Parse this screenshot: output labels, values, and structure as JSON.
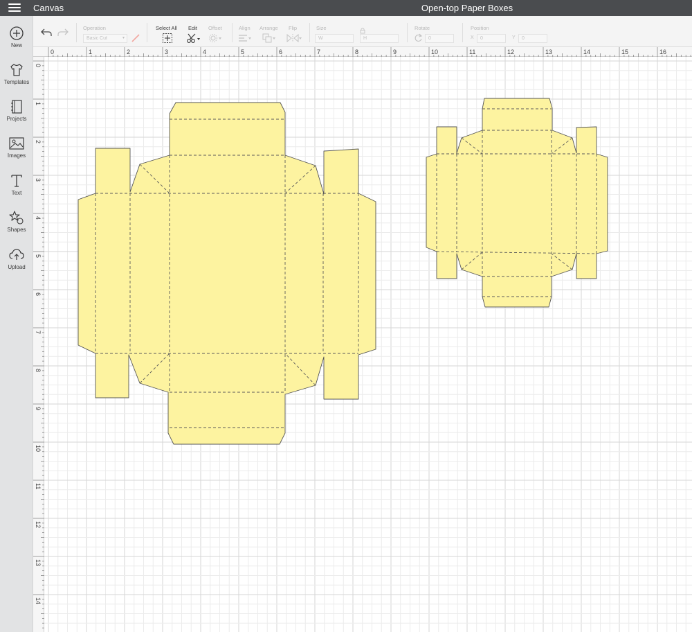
{
  "header": {
    "app_title": "Canvas",
    "project_title": "Open-top Paper Boxes"
  },
  "sidebar": {
    "items": [
      {
        "label": "New",
        "icon": "plus-circle-icon"
      },
      {
        "label": "Templates",
        "icon": "tshirt-icon"
      },
      {
        "label": "Projects",
        "icon": "notebook-icon"
      },
      {
        "label": "Images",
        "icon": "image-icon"
      },
      {
        "label": "Text",
        "icon": "text-t-icon"
      },
      {
        "label": "Shapes",
        "icon": "shapes-icon"
      },
      {
        "label": "Upload",
        "icon": "cloud-upload-icon"
      }
    ]
  },
  "toolbar": {
    "operation_label": "Operation",
    "operation_value": "Basic Cut",
    "select_all_label": "Select All",
    "edit_label": "Edit",
    "offset_label": "Offset",
    "align_label": "Align",
    "arrange_label": "Arrange",
    "flip_label": "Flip",
    "size_label": "Size",
    "size_w_label": "W",
    "size_h_label": "H",
    "rotate_label": "Rotate",
    "rotate_value": "0",
    "position_label": "Position",
    "position_x_label": "X",
    "position_x_value": "0",
    "position_y_label": "Y",
    "position_y_value": "0"
  },
  "rulers": {
    "horizontal": [
      "0",
      "1",
      "2",
      "3",
      "4",
      "5",
      "6",
      "7",
      "8",
      "9",
      "10",
      "11",
      "12",
      "13",
      "14",
      "15",
      "16"
    ],
    "vertical": [
      "0",
      "1",
      "2",
      "3",
      "4",
      "5",
      "6",
      "7",
      "8",
      "9",
      "10",
      "11",
      "12",
      "13",
      "14"
    ]
  },
  "colors": {
    "topbar": "#4a4c4f",
    "sidebar": "#e2e3e4",
    "box_fill": "#fdf3a0",
    "outline": "#555555",
    "score_line": "#5a5a5a",
    "grid_minor": "#ececec",
    "grid_major": "#d6d6d6"
  }
}
